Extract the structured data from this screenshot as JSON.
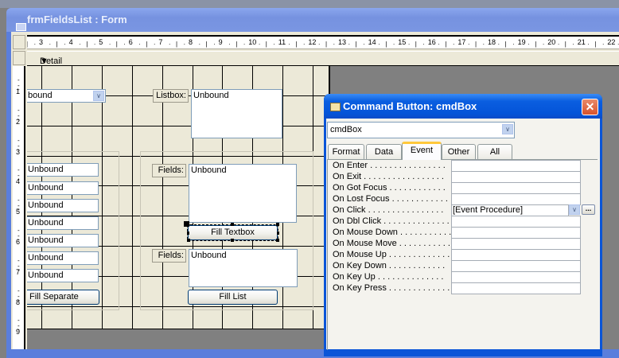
{
  "window": {
    "title": "frmFieldsList : Form"
  },
  "ruler": {
    "horizontal": [
      "3",
      "4",
      "5",
      "6",
      "7",
      "8",
      "9",
      "10",
      "11",
      "12",
      "13",
      "14",
      "15",
      "16",
      "17",
      "18",
      "19",
      "20",
      "21",
      "22"
    ],
    "vertical": [
      "1",
      "2",
      "3",
      "4",
      "5",
      "6",
      "7",
      "8",
      "9"
    ]
  },
  "section": {
    "detail_label": "Detail"
  },
  "form": {
    "combo_value": "bound",
    "listbox_label": "Listbox:",
    "listbox_value": "Unbound",
    "textboxes": [
      "Unbound",
      "Unbound",
      "Unbound",
      "Unbound",
      "Unbound",
      "Unbound",
      "Unbound"
    ],
    "fill_separate_label": "Fill Separate",
    "fields_label_1": "Fields:",
    "fields_value_1": "Unbound",
    "fill_textbox_label": "Fill Textbox",
    "fields_label_2": "Fields:",
    "fields_value_2": "Unbound",
    "fill_list_label": "Fill List"
  },
  "property_sheet": {
    "title": "Command Button: cmdBox",
    "object_select": "cmdBox",
    "tabs": [
      "Format",
      "Data",
      "Event",
      "Other",
      "All"
    ],
    "active_tab": "Event",
    "rows": [
      {
        "label": "On Enter . . . . . . . . . . . . . . . .",
        "value": ""
      },
      {
        "label": "On Exit . . . . . . . . . . . . . . . . .",
        "value": ""
      },
      {
        "label": "On Got Focus . . . . . . . . . . . .",
        "value": ""
      },
      {
        "label": "On Lost Focus . . . . . . . . . . . .",
        "value": ""
      },
      {
        "label": "On Click . . . . . . . . . . . . . . . .",
        "value": "[Event Procedure]"
      },
      {
        "label": "On Dbl Click . . . . . . . . . . . . . .",
        "value": ""
      },
      {
        "label": "On Mouse Down . . . . . . . . . . .",
        "value": ""
      },
      {
        "label": "On Mouse Move . . . . . . . . . . .",
        "value": ""
      },
      {
        "label": "On Mouse Up . . . . . . . . . . . . .",
        "value": ""
      },
      {
        "label": "On Key Down . . . . . . . . . . . .",
        "value": ""
      },
      {
        "label": "On Key Up . . . . . . . . . . . . . .",
        "value": ""
      },
      {
        "label": "On Key Press . . . . . . . . . . . . .",
        "value": ""
      }
    ],
    "build_button_label": "...",
    "close_glyph": "✕"
  }
}
